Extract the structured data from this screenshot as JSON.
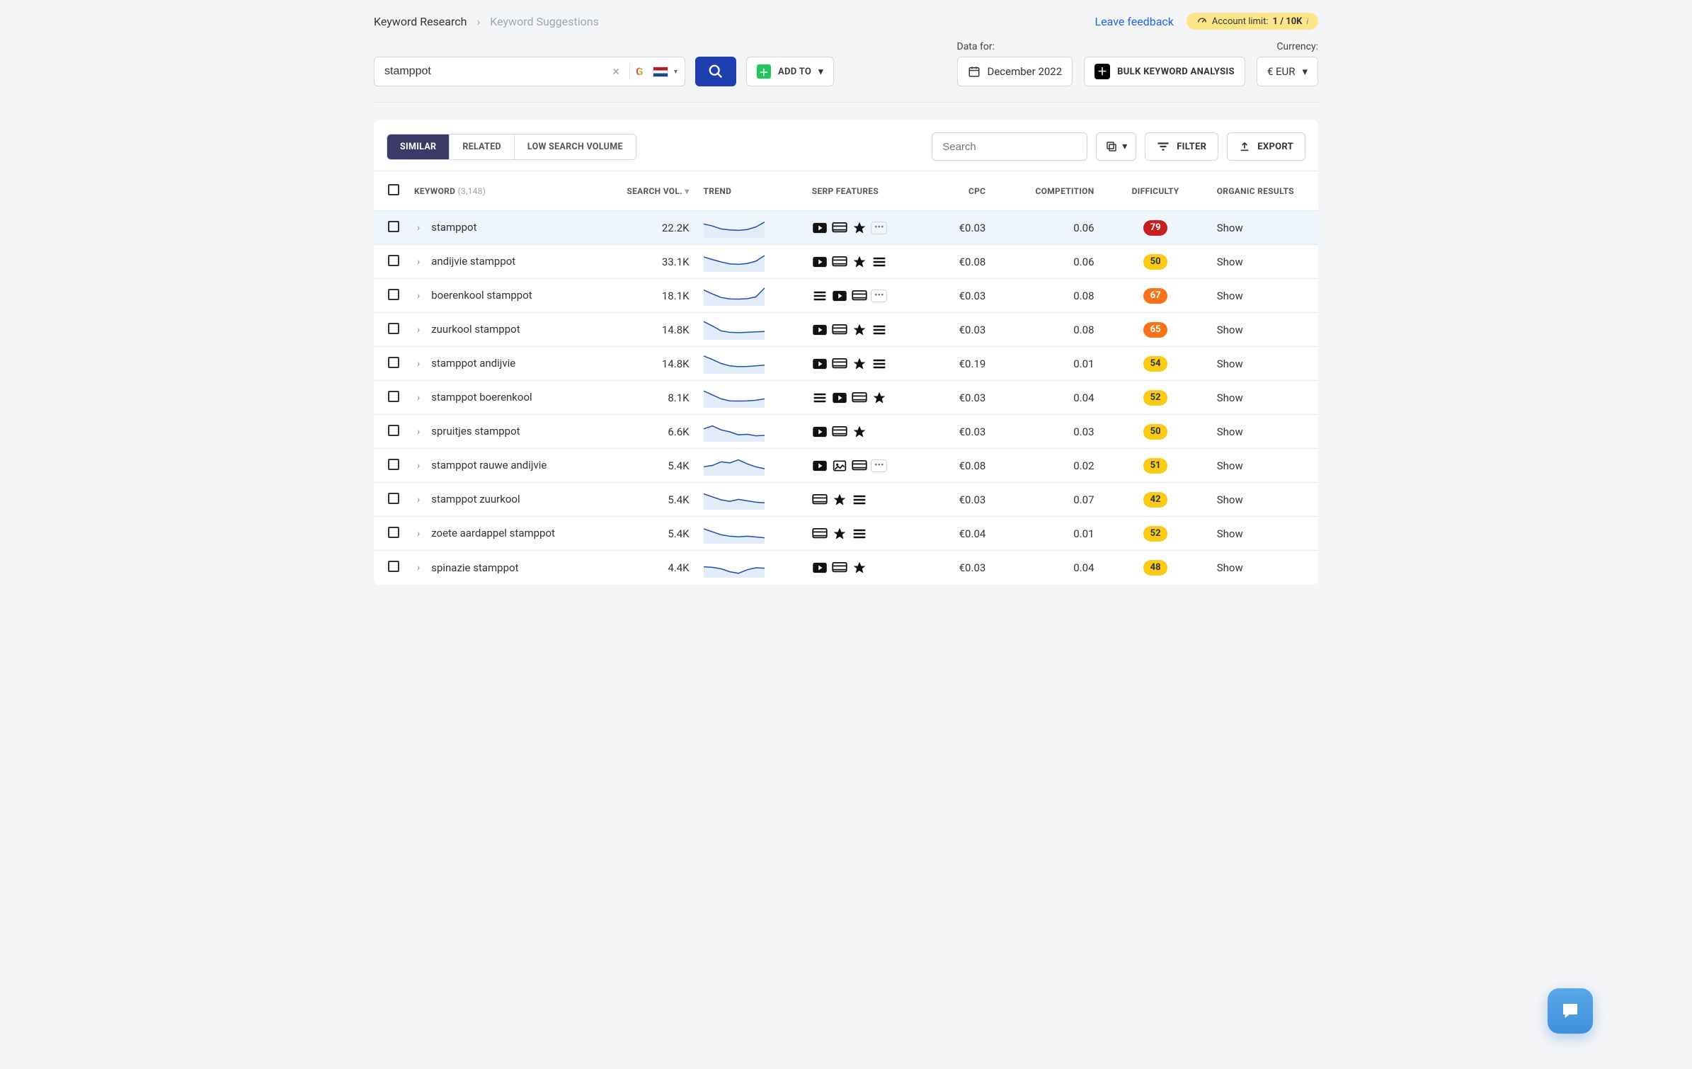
{
  "breadcrumbs": {
    "root": "Keyword Research",
    "current": "Keyword Suggestions"
  },
  "top": {
    "feedback": "Leave feedback",
    "limit_prefix": "Account limit:",
    "limit_value": "1 / 10K",
    "limit_sup": "i"
  },
  "search": {
    "value": "stamppot",
    "addto": "ADD TO",
    "data_label": "Data for:",
    "date": "December 2022",
    "bulk": "BULK KEYWORD ANALYSIS",
    "currency_label": "Currency:",
    "currency": "€ EUR"
  },
  "tabs": {
    "similar": "SIMILAR",
    "related": "RELATED",
    "lowvol": "LOW SEARCH VOLUME"
  },
  "toolbar": {
    "search_ph": "Search",
    "filter": "FILTER",
    "export": "EXPORT"
  },
  "columns": {
    "keyword": "KEYWORD",
    "count": "(3,148)",
    "vol": "SEARCH VOL.",
    "trend": "TREND",
    "serp": "SERP FEATURES",
    "cpc": "CPC",
    "comp": "COMPETITION",
    "diff": "DIFFICULTY",
    "org": "ORGANIC RESULTS"
  },
  "show_label": "Show",
  "rows": [
    {
      "kw": "stamppot",
      "vol": "22.2K",
      "cpc": "€0.03",
      "comp": "0.06",
      "diff": 79,
      "diffc": "red",
      "serp": [
        "video",
        "card",
        "star",
        "more"
      ],
      "hl": true,
      "spark": [
        0.3,
        0.4,
        0.55,
        0.6,
        0.62,
        0.58,
        0.45,
        0.2
      ]
    },
    {
      "kw": "andijvie stamppot",
      "vol": "33.1K",
      "cpc": "€0.08",
      "comp": "0.06",
      "diff": 50,
      "diffc": "yellow",
      "serp": [
        "video",
        "card",
        "star",
        "list"
      ],
      "spark": [
        0.25,
        0.38,
        0.5,
        0.6,
        0.62,
        0.58,
        0.46,
        0.18
      ]
    },
    {
      "kw": "boerenkool stamppot",
      "vol": "18.1K",
      "cpc": "€0.03",
      "comp": "0.08",
      "diff": 67,
      "diffc": "orange",
      "serp": [
        "list",
        "video",
        "card",
        "more"
      ],
      "spark": [
        0.2,
        0.4,
        0.58,
        0.65,
        0.66,
        0.64,
        0.55,
        0.1
      ]
    },
    {
      "kw": "zuurkool stamppot",
      "vol": "14.8K",
      "cpc": "€0.03",
      "comp": "0.08",
      "diff": 65,
      "diffc": "orange",
      "serp": [
        "video",
        "card",
        "star",
        "list"
      ],
      "spark": [
        0.08,
        0.3,
        0.55,
        0.62,
        0.64,
        0.62,
        0.6,
        0.58
      ]
    },
    {
      "kw": "stamppot andijvie",
      "vol": "14.8K",
      "cpc": "€0.19",
      "comp": "0.01",
      "diff": 54,
      "diffc": "yellow",
      "serp": [
        "video",
        "card",
        "star",
        "list"
      ],
      "spark": [
        0.1,
        0.28,
        0.48,
        0.6,
        0.64,
        0.63,
        0.6,
        0.56
      ]
    },
    {
      "kw": "stamppot boerenkool",
      "vol": "8.1K",
      "cpc": "€0.03",
      "comp": "0.04",
      "diff": 52,
      "diffc": "yellow",
      "serp": [
        "list",
        "video",
        "card",
        "star"
      ],
      "spark": [
        0.15,
        0.35,
        0.55,
        0.65,
        0.66,
        0.65,
        0.62,
        0.55
      ]
    },
    {
      "kw": "spruitjes stamppot",
      "vol": "6.6K",
      "cpc": "€0.03",
      "comp": "0.03",
      "diff": 50,
      "diffc": "yellow",
      "serp": [
        "video",
        "card",
        "star"
      ],
      "spark": [
        0.35,
        0.2,
        0.4,
        0.5,
        0.65,
        0.62,
        0.7,
        0.68
      ]
    },
    {
      "kw": "stamppot rauwe andijvie",
      "vol": "5.4K",
      "cpc": "€0.08",
      "comp": "0.02",
      "diff": 51,
      "diffc": "yellow",
      "serp": [
        "video",
        "image",
        "card",
        "more"
      ],
      "spark": [
        0.55,
        0.48,
        0.3,
        0.35,
        0.2,
        0.4,
        0.55,
        0.65
      ]
    },
    {
      "kw": "stamppot zuurkool",
      "vol": "5.4K",
      "cpc": "€0.03",
      "comp": "0.07",
      "diff": 42,
      "diffc": "yellow",
      "serp": [
        "card",
        "star",
        "list"
      ],
      "spark": [
        0.2,
        0.35,
        0.5,
        0.58,
        0.48,
        0.55,
        0.62,
        0.65
      ]
    },
    {
      "kw": "zoete aardappel stamppot",
      "vol": "5.4K",
      "cpc": "€0.04",
      "comp": "0.01",
      "diff": 52,
      "diffc": "yellow",
      "serp": [
        "card",
        "star",
        "list"
      ],
      "spark": [
        0.25,
        0.4,
        0.55,
        0.62,
        0.65,
        0.62,
        0.66,
        0.7
      ]
    },
    {
      "kw": "spinazie stamppot",
      "vol": "4.4K",
      "cpc": "€0.03",
      "comp": "0.04",
      "diff": 48,
      "diffc": "yellow",
      "serp": [
        "video",
        "card",
        "star"
      ],
      "spark": [
        0.45,
        0.48,
        0.55,
        0.7,
        0.78,
        0.6,
        0.5,
        0.52
      ]
    }
  ]
}
